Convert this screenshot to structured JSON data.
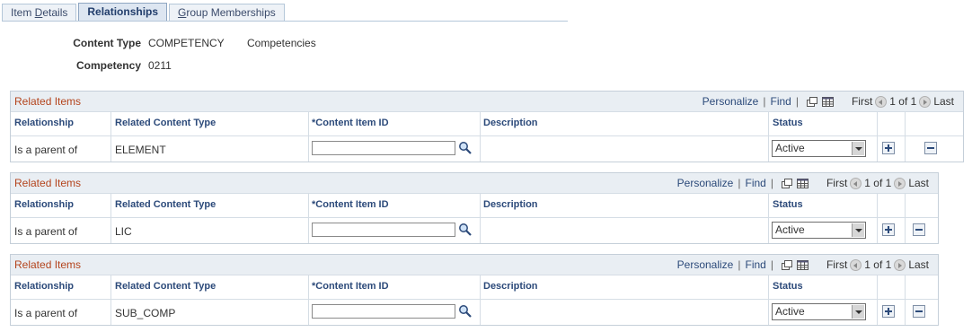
{
  "tabs": [
    {
      "label_pre": "Item ",
      "label_ul": "D",
      "label_post": "etails"
    },
    {
      "label_pre": "",
      "label_ul": "",
      "label_post": "Relationships"
    },
    {
      "label_pre": "",
      "label_ul": "G",
      "label_post": "roup Memberships"
    }
  ],
  "header": {
    "content_type_label": "Content Type",
    "content_type_value": "COMPETENCY",
    "content_type_desc": "Competencies",
    "competency_label": "Competency",
    "competency_value": "0211"
  },
  "grid_common": {
    "title": "Related Items",
    "personalize": "Personalize",
    "find": "Find",
    "first": "First",
    "of": "1 of 1",
    "last": "Last",
    "sep": "|",
    "columns": [
      "Relationship",
      "Related Content Type",
      "*Content Item ID",
      "Description",
      "Status"
    ]
  },
  "grids": [
    {
      "relationship": "Is a parent of",
      "content_type": "ELEMENT",
      "content_item_id": "",
      "description": "",
      "status": "Active"
    },
    {
      "relationship": "Is a parent of",
      "content_type": "LIC",
      "content_item_id": "",
      "description": "",
      "status": "Active"
    },
    {
      "relationship": "Is a parent of",
      "content_type": "SUB_COMP",
      "content_item_id": "",
      "description": "",
      "status": "Active"
    }
  ],
  "icons": {
    "lookup": "magnifier-icon",
    "view_all": "view-all-icon",
    "download": "spreadsheet-icon",
    "prev": "previous-icon",
    "next": "next-icon",
    "add": "plus-icon",
    "delete": "minus-icon"
  },
  "colors": {
    "grid_title": "#b4441d",
    "link": "#2c4a7a",
    "grid_header_bg": "#e9eef3"
  }
}
